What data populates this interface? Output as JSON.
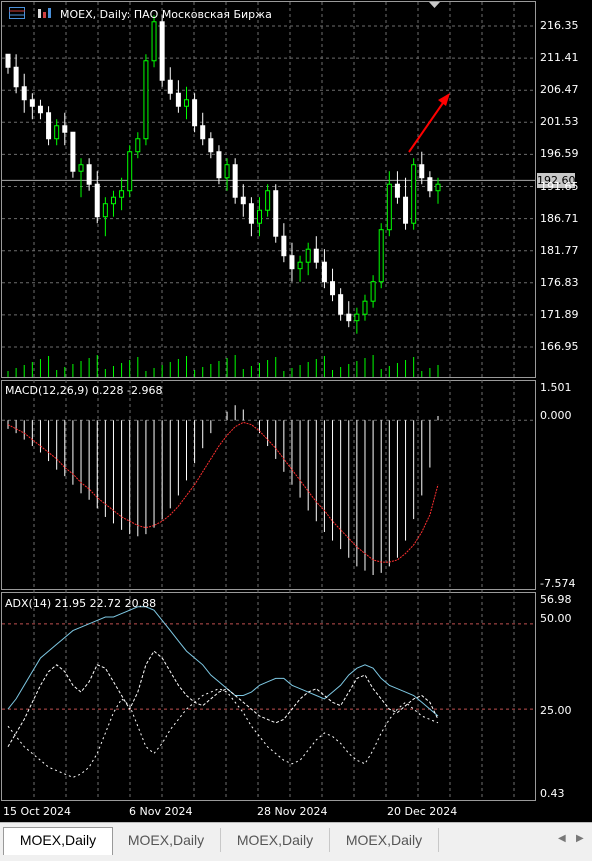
{
  "header": {
    "symbol_title": "MOEX, Daily:  ПАО Московская Биржа"
  },
  "price_axis": {
    "ticks": [
      "216.35",
      "211.41",
      "206.47",
      "201.53",
      "196.59",
      "191.65",
      "186.71",
      "181.77",
      "176.83",
      "171.89",
      "166.95"
    ],
    "current_price": "192.60"
  },
  "macd": {
    "label": "MACD(12,26,9) 0.228 -2.968",
    "ticks": [
      "1.501",
      "0.000",
      "-7.574"
    ]
  },
  "adx": {
    "label": "ADX(14) 21.95 22.72 20.88",
    "ticks": [
      "56.98",
      "50.00",
      "25.00",
      "0.43"
    ]
  },
  "time_axis": {
    "labels": [
      "15 Oct 2024",
      "6 Nov 2024",
      "28 Nov 2024",
      "20 Dec 2024"
    ]
  },
  "tabs": [
    "MOEX,Daily",
    "MOEX,Daily",
    "MOEX,Daily",
    "MOEX,Daily"
  ],
  "colors": {
    "up": "#00ff00",
    "down": "#ffffff",
    "grid": "#6e6e6e",
    "signal": "#ff3030",
    "adx_line": "#7ec8e3",
    "arrow": "#ff0000"
  },
  "chart_data": [
    {
      "type": "candlestick",
      "title": "MOEX, Daily:  ПАО Московская Биржа",
      "ylim": [
        163.5,
        220.0
      ],
      "x_labels": [
        "15 Oct 2024",
        "6 Nov 2024",
        "28 Nov 2024",
        "20 Dec 2024"
      ],
      "candles": [
        [
          212,
          212,
          209,
          210
        ],
        [
          210,
          212,
          206,
          207
        ],
        [
          207,
          209,
          203,
          205
        ],
        [
          205,
          206,
          202,
          204
        ],
        [
          204,
          205,
          202,
          203
        ],
        [
          203,
          204,
          198,
          199
        ],
        [
          199,
          202,
          198,
          201
        ],
        [
          201,
          203,
          198,
          200
        ],
        [
          200,
          200,
          193,
          194
        ],
        [
          194,
          196,
          190,
          195
        ],
        [
          195,
          196,
          191,
          192
        ],
        [
          192,
          194,
          186,
          187
        ],
        [
          187,
          190,
          184,
          189
        ],
        [
          189,
          191,
          187,
          190
        ],
        [
          190,
          193,
          188,
          191
        ],
        [
          191,
          198,
          190,
          197
        ],
        [
          197,
          200,
          196,
          199
        ],
        [
          199,
          212,
          198,
          211
        ],
        [
          211,
          218,
          210,
          217
        ],
        [
          217,
          218,
          207,
          208
        ],
        [
          208,
          210,
          205,
          206
        ],
        [
          206,
          208,
          203,
          204
        ],
        [
          204,
          207,
          202,
          205
        ],
        [
          205,
          206,
          200,
          201
        ],
        [
          201,
          203,
          198,
          199
        ],
        [
          199,
          200,
          196,
          197
        ],
        [
          197,
          198,
          192,
          193
        ],
        [
          193,
          196,
          191,
          195
        ],
        [
          195,
          196,
          189,
          190
        ],
        [
          190,
          192,
          187,
          189
        ],
        [
          189,
          190,
          184,
          186
        ],
        [
          186,
          190,
          184,
          188
        ],
        [
          188,
          192,
          187,
          191
        ],
        [
          191,
          192,
          183,
          184
        ],
        [
          184,
          186,
          180,
          181
        ],
        [
          181,
          183,
          177,
          179
        ],
        [
          179,
          181,
          177,
          180
        ],
        [
          180,
          183,
          178,
          182
        ],
        [
          182,
          184,
          179,
          180
        ],
        [
          180,
          182,
          176,
          177
        ],
        [
          177,
          179,
          174,
          175
        ],
        [
          175,
          176,
          171,
          172
        ],
        [
          172,
          174,
          170,
          171
        ],
        [
          171,
          173,
          169,
          172
        ],
        [
          172,
          175,
          171,
          174
        ],
        [
          174,
          178,
          173,
          177
        ],
        [
          177,
          186,
          176,
          185
        ],
        [
          185,
          194,
          184,
          192
        ],
        [
          192,
          194,
          189,
          190
        ],
        [
          190,
          193,
          185,
          186
        ],
        [
          186,
          196,
          185,
          195
        ],
        [
          195,
          197,
          192,
          193
        ],
        [
          193,
          194,
          190,
          191
        ],
        [
          191,
          193,
          189,
          192
        ]
      ],
      "volume_level": "low-bars at base"
    },
    {
      "type": "bar+line",
      "title": "MACD(12,26,9) 0.228 -2.968",
      "ylim": [
        -7.574,
        1.501
      ],
      "series": [
        {
          "values": [
            -0.4,
            -0.6,
            -0.9,
            -1.2,
            -1.5,
            -1.9,
            -2.3,
            -2.6,
            -3.0,
            -3.4,
            -3.7,
            -4.1,
            -4.5,
            -4.8,
            -5.1,
            -5.3,
            -5.4,
            -5.3,
            -5.0,
            -4.6,
            -4.1,
            -3.5,
            -2.8,
            -2.0,
            -1.3,
            -0.6,
            0.0,
            0.4,
            0.7,
            0.5,
            0.0,
            -0.6,
            -1.2,
            -1.8,
            -2.4,
            -3.0,
            -3.6,
            -4.2,
            -4.7,
            -5.2,
            -5.6,
            -6.0,
            -6.4,
            -6.8,
            -7.0,
            -7.2,
            -7.1,
            -6.8,
            -6.4,
            -5.6,
            -4.6,
            -3.5,
            -2.2,
            0.2
          ]
        },
        {
          "values": [
            -0.2,
            -0.4,
            -0.6,
            -0.9,
            -1.2,
            -1.5,
            -1.8,
            -2.2,
            -2.5,
            -2.9,
            -3.2,
            -3.6,
            -3.9,
            -4.2,
            -4.5,
            -4.7,
            -4.9,
            -5.0,
            -4.9,
            -4.7,
            -4.4,
            -4.0,
            -3.5,
            -3.0,
            -2.4,
            -1.8,
            -1.2,
            -0.7,
            -0.3,
            -0.1,
            -0.2,
            -0.5,
            -0.9,
            -1.3,
            -1.8,
            -2.3,
            -2.8,
            -3.3,
            -3.8,
            -4.2,
            -4.7,
            -5.1,
            -5.5,
            -5.9,
            -6.2,
            -6.5,
            -6.6,
            -6.6,
            -6.5,
            -6.2,
            -5.8,
            -5.2,
            -4.4,
            -3.0
          ]
        }
      ]
    },
    {
      "type": "line",
      "title": "ADX(14) 21.95 22.72 20.88",
      "ylim": [
        0.43,
        56.98
      ],
      "series": [
        {
          "values": [
            25,
            28,
            32,
            36,
            40,
            42,
            44,
            46,
            48,
            49,
            50,
            51,
            52,
            52,
            53,
            54,
            55,
            55,
            54,
            51,
            48,
            45,
            42,
            40,
            38,
            35,
            33,
            31,
            29,
            29,
            30,
            32,
            33,
            34,
            34,
            32,
            31,
            30,
            29,
            28,
            30,
            32,
            35,
            37,
            38,
            37,
            34,
            32,
            31,
            30,
            29,
            27,
            25,
            23
          ]
        },
        {
          "values": [
            14,
            18,
            22,
            27,
            32,
            36,
            38,
            36,
            32,
            30,
            33,
            38,
            37,
            33,
            29,
            25,
            30,
            38,
            42,
            40,
            36,
            32,
            29,
            27,
            26,
            28,
            30,
            31,
            29,
            27,
            25,
            23,
            22,
            21,
            22,
            25,
            28,
            30,
            31,
            29,
            27,
            26,
            30,
            34,
            35,
            31,
            28,
            25,
            24,
            26,
            28,
            29,
            27,
            22
          ]
        },
        {
          "values": [
            20,
            17,
            14,
            12,
            10,
            8,
            7,
            6,
            5,
            6,
            8,
            12,
            18,
            24,
            28,
            26,
            20,
            14,
            12,
            15,
            19,
            22,
            25,
            27,
            29,
            30,
            31,
            30,
            27,
            24,
            20,
            17,
            14,
            12,
            10,
            9,
            10,
            13,
            16,
            18,
            17,
            15,
            12,
            10,
            9,
            13,
            18,
            22,
            25,
            27,
            25,
            23,
            22,
            21
          ]
        }
      ]
    }
  ]
}
